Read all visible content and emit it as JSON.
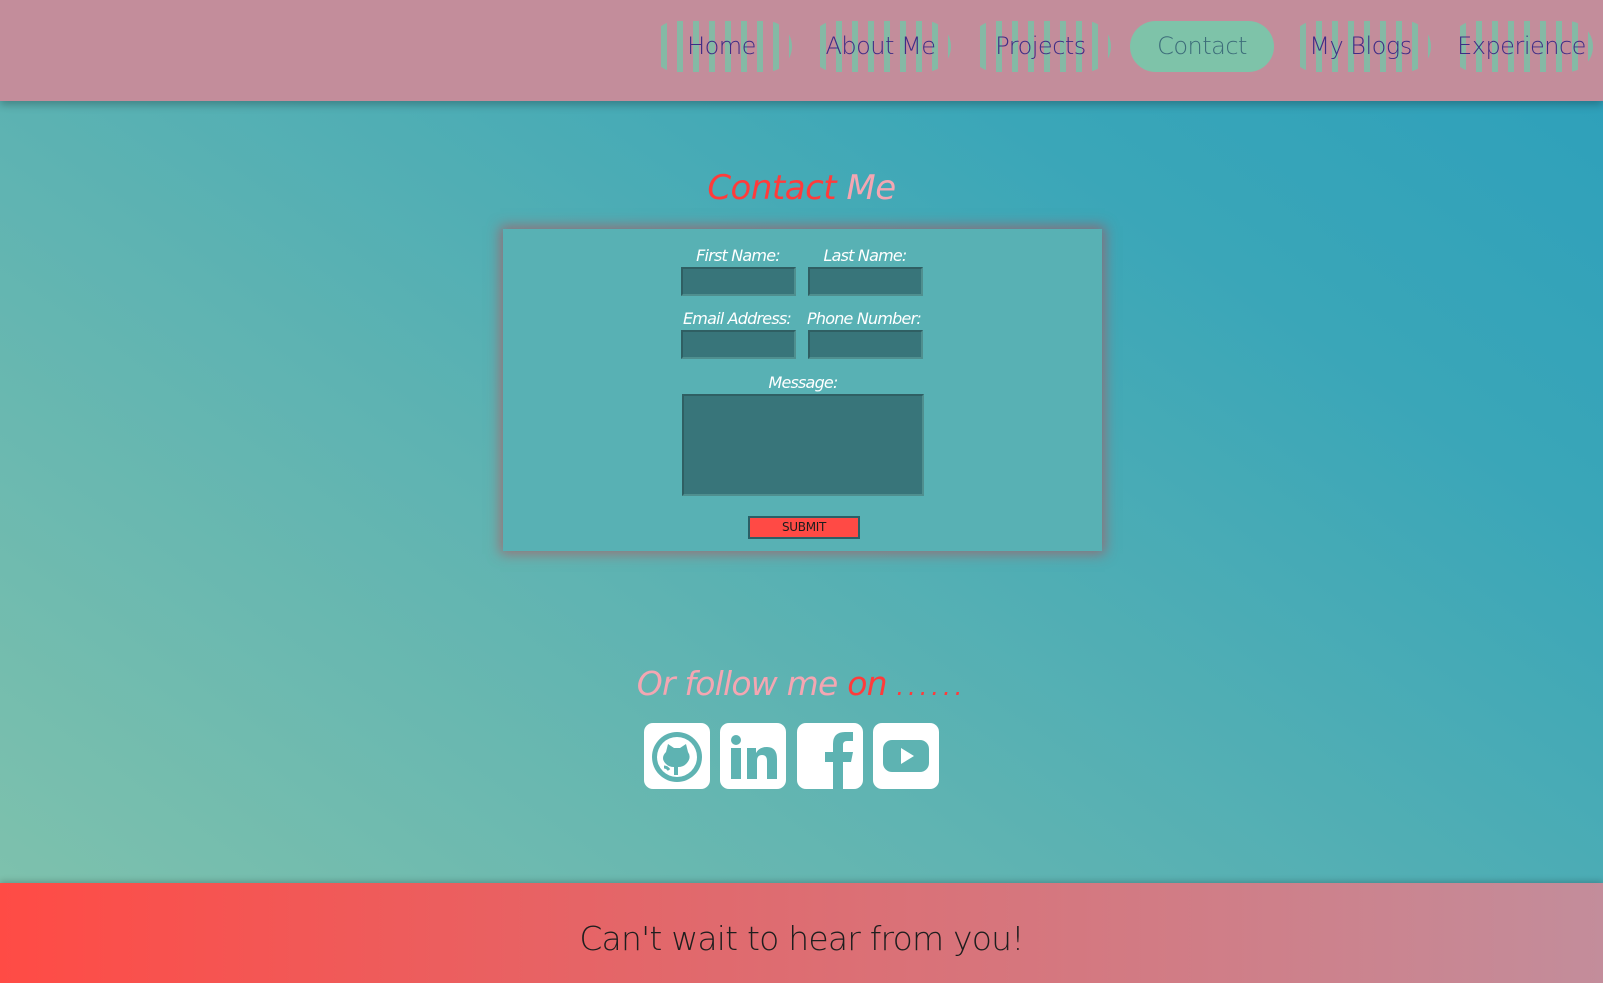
{
  "nav": {
    "items": [
      {
        "label": "Home",
        "active": false
      },
      {
        "label": "About Me",
        "active": false
      },
      {
        "label": "Projects",
        "active": false
      },
      {
        "label": "Contact",
        "active": true
      },
      {
        "label": "My Blogs",
        "active": false
      },
      {
        "label": "Experience",
        "active": false
      }
    ]
  },
  "contact": {
    "title_word1": "Contact",
    "title_word2": "Me",
    "form": {
      "first_name_label": "First Name:",
      "last_name_label": "Last Name:",
      "email_label": "Email Address:",
      "phone_label": "Phone Number:",
      "message_label": "Message:",
      "first_name_value": "",
      "last_name_value": "",
      "email_value": "",
      "phone_value": "",
      "message_value": "",
      "submit_label": "SUBMIT"
    }
  },
  "follow": {
    "part1": "Or follow me",
    "part2": "on",
    "part3": "......",
    "links": [
      {
        "icon": "github-icon"
      },
      {
        "icon": "linkedin-icon"
      },
      {
        "icon": "facebook-icon"
      },
      {
        "icon": "youtube-icon"
      }
    ]
  },
  "footer": {
    "text": "Can't wait to hear from you!"
  },
  "colors": {
    "header_bg": "#c38d9b",
    "nav_text": "#3f2c86",
    "nav_active_bg": "#7ec3a9",
    "accent_red": "#ff3b3b",
    "accent_pink": "#f4a6b2",
    "card_bg": "#58b1b4",
    "field_bg": "#38757a",
    "submit_bg": "#ff4a45"
  }
}
